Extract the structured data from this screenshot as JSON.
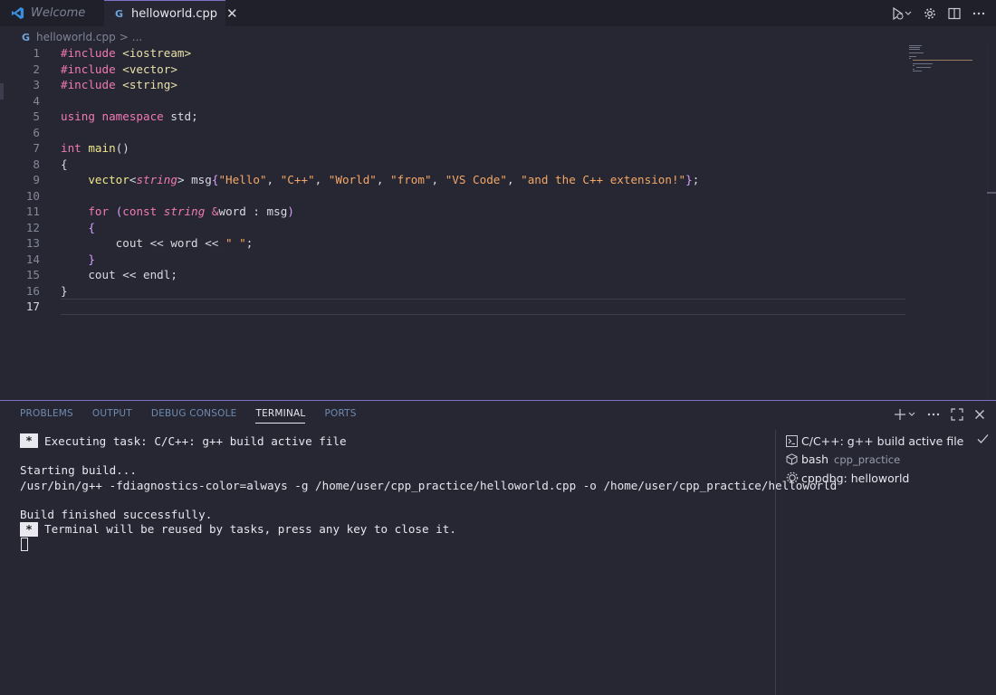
{
  "tabs": {
    "welcome_label": "Welcome",
    "active_label": "helloworld.cpp",
    "close_glyph": "✕"
  },
  "breadcrumb": {
    "file": "helloworld.cpp",
    "sep": ">",
    "more": "..."
  },
  "editor": {
    "line_numbers": [
      "1",
      "2",
      "3",
      "4",
      "5",
      "6",
      "7",
      "8",
      "9",
      "10",
      "11",
      "12",
      "13",
      "14",
      "15",
      "16",
      "17"
    ]
  },
  "panel": {
    "tabs": [
      "PROBLEMS",
      "OUTPUT",
      "DEBUG CONSOLE",
      "TERMINAL",
      "PORTS"
    ],
    "active_tab": "TERMINAL"
  },
  "terminal": {
    "star": "*",
    "line1": "Executing task: C/C++: g++ build active file",
    "line2": "Starting build...",
    "line3": "/usr/bin/g++ -fdiagnostics-color=always -g /home/user/cpp_practice/helloworld.cpp -o /home/user/cpp_practice/helloworld",
    "line4": "Build finished successfully.",
    "line5": "Terminal will be reused by tasks, press any key to close it."
  },
  "terminal_list": {
    "item1": "C/C++: g++ build active file",
    "item2": "bash",
    "item2_sub": "cpp_practice",
    "item3": "cppdbg: helloworld"
  },
  "colors": {
    "accent": "#7e6fc2",
    "keyword": "#f07ab4",
    "string": "#f4a766",
    "function": "#f0e68c"
  }
}
